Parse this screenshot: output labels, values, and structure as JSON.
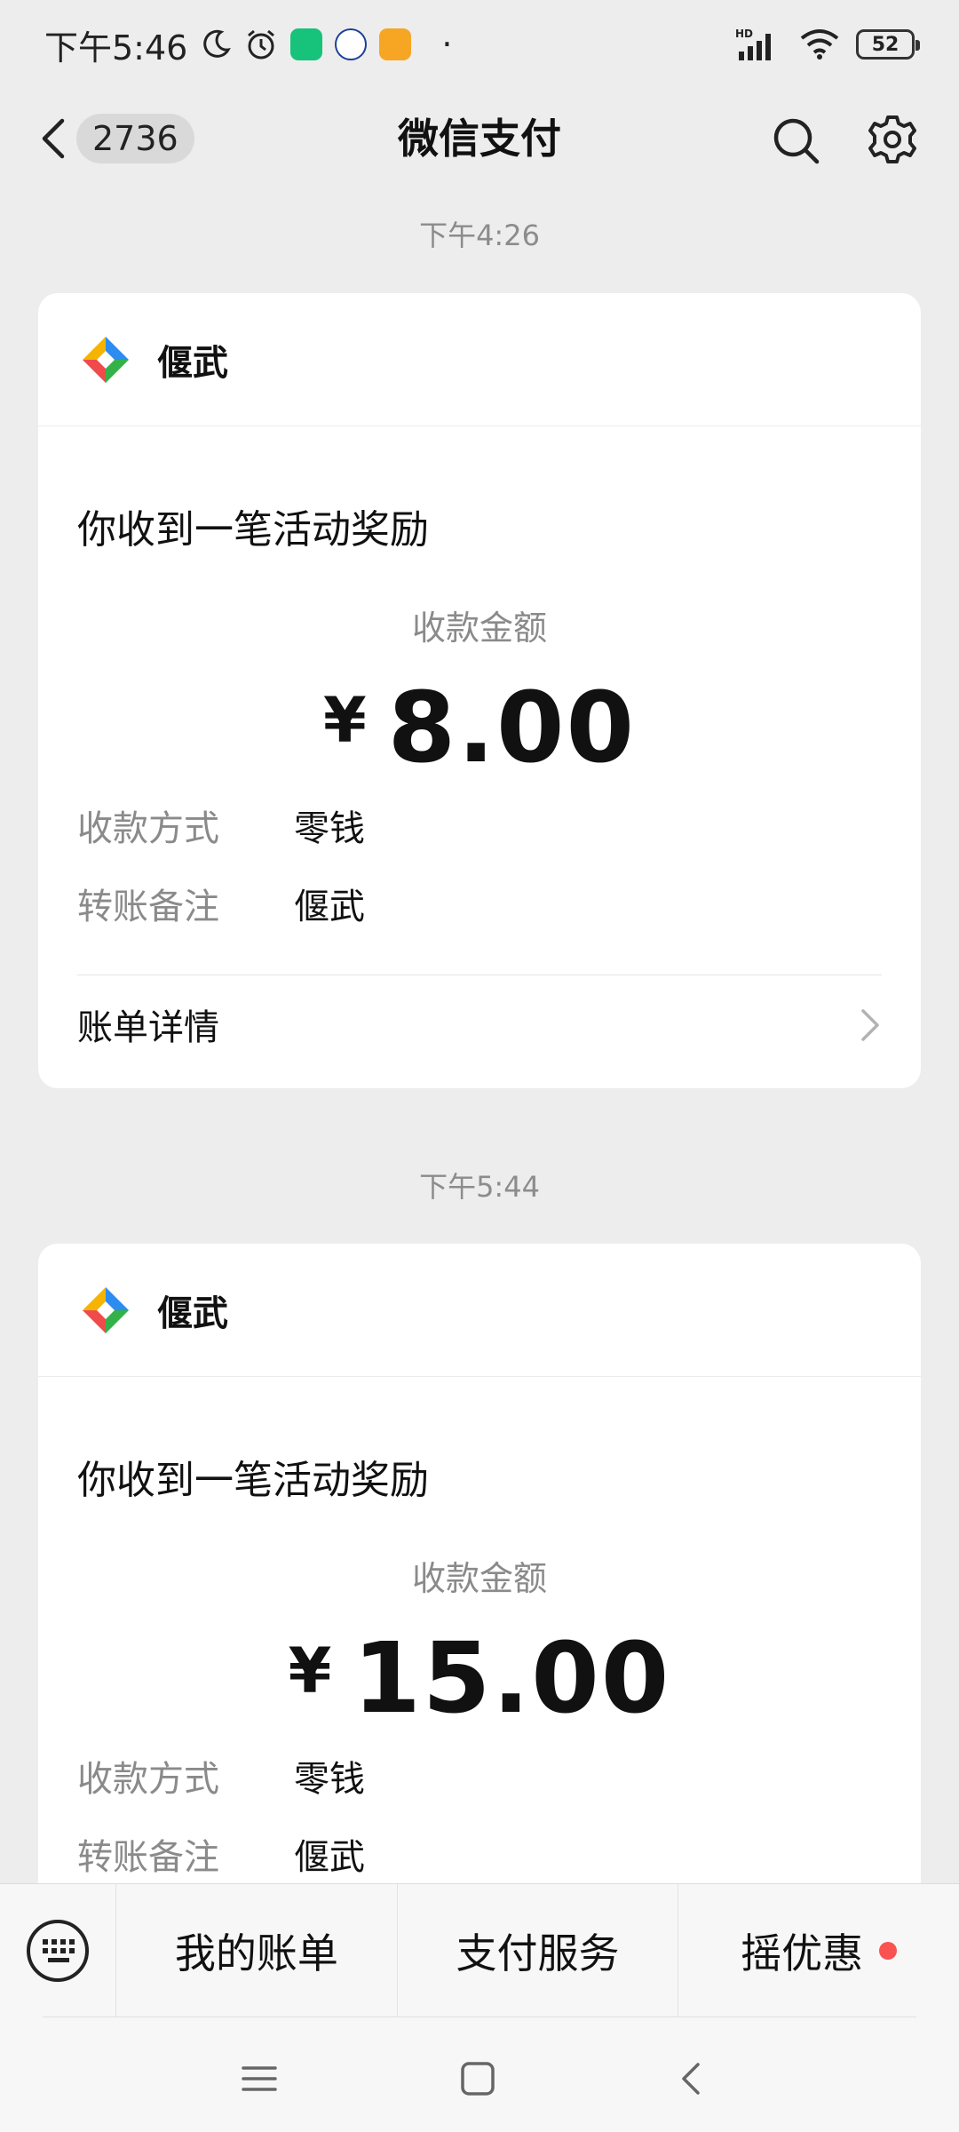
{
  "status_bar": {
    "time": "下午5:46",
    "battery": "52",
    "dot": "·"
  },
  "nav": {
    "title": "微信支付",
    "unread_count": "2736"
  },
  "messages": [
    {
      "time": "下午4:26",
      "merchant": "偃武",
      "title": "你收到一笔活动奖励",
      "amount_caption": "收款金额",
      "currency": "¥",
      "amount": "8.00",
      "method_label": "收款方式",
      "method_value": "零钱",
      "note_label": "转账备注",
      "note_value": "偃武",
      "link_label": "账单详情"
    },
    {
      "time": "下午5:44",
      "merchant": "偃武",
      "title": "你收到一笔活动奖励",
      "amount_caption": "收款金额",
      "currency": "¥",
      "amount": "15.00",
      "method_label": "收款方式",
      "method_value": "零钱",
      "note_label": "转账备注",
      "note_value": "偃武"
    }
  ],
  "bottom_menu": {
    "items": [
      "我的账单",
      "支付服务",
      "摇优惠"
    ]
  },
  "colors": {
    "background": "#ededed",
    "card": "#ffffff",
    "badge_red": "#fa5151",
    "muted_text": "#8a8a8a"
  },
  "icons": [
    "moon-icon",
    "alarm-icon",
    "app-icons",
    "hd-signal-icon",
    "wifi-icon",
    "battery-icon",
    "back-arrow-icon",
    "search-icon",
    "gear-icon",
    "merchant-logo",
    "chevron-right-icon",
    "keyboard-icon",
    "menu-lines-icon",
    "home-square-icon",
    "back-chevron-icon"
  ]
}
